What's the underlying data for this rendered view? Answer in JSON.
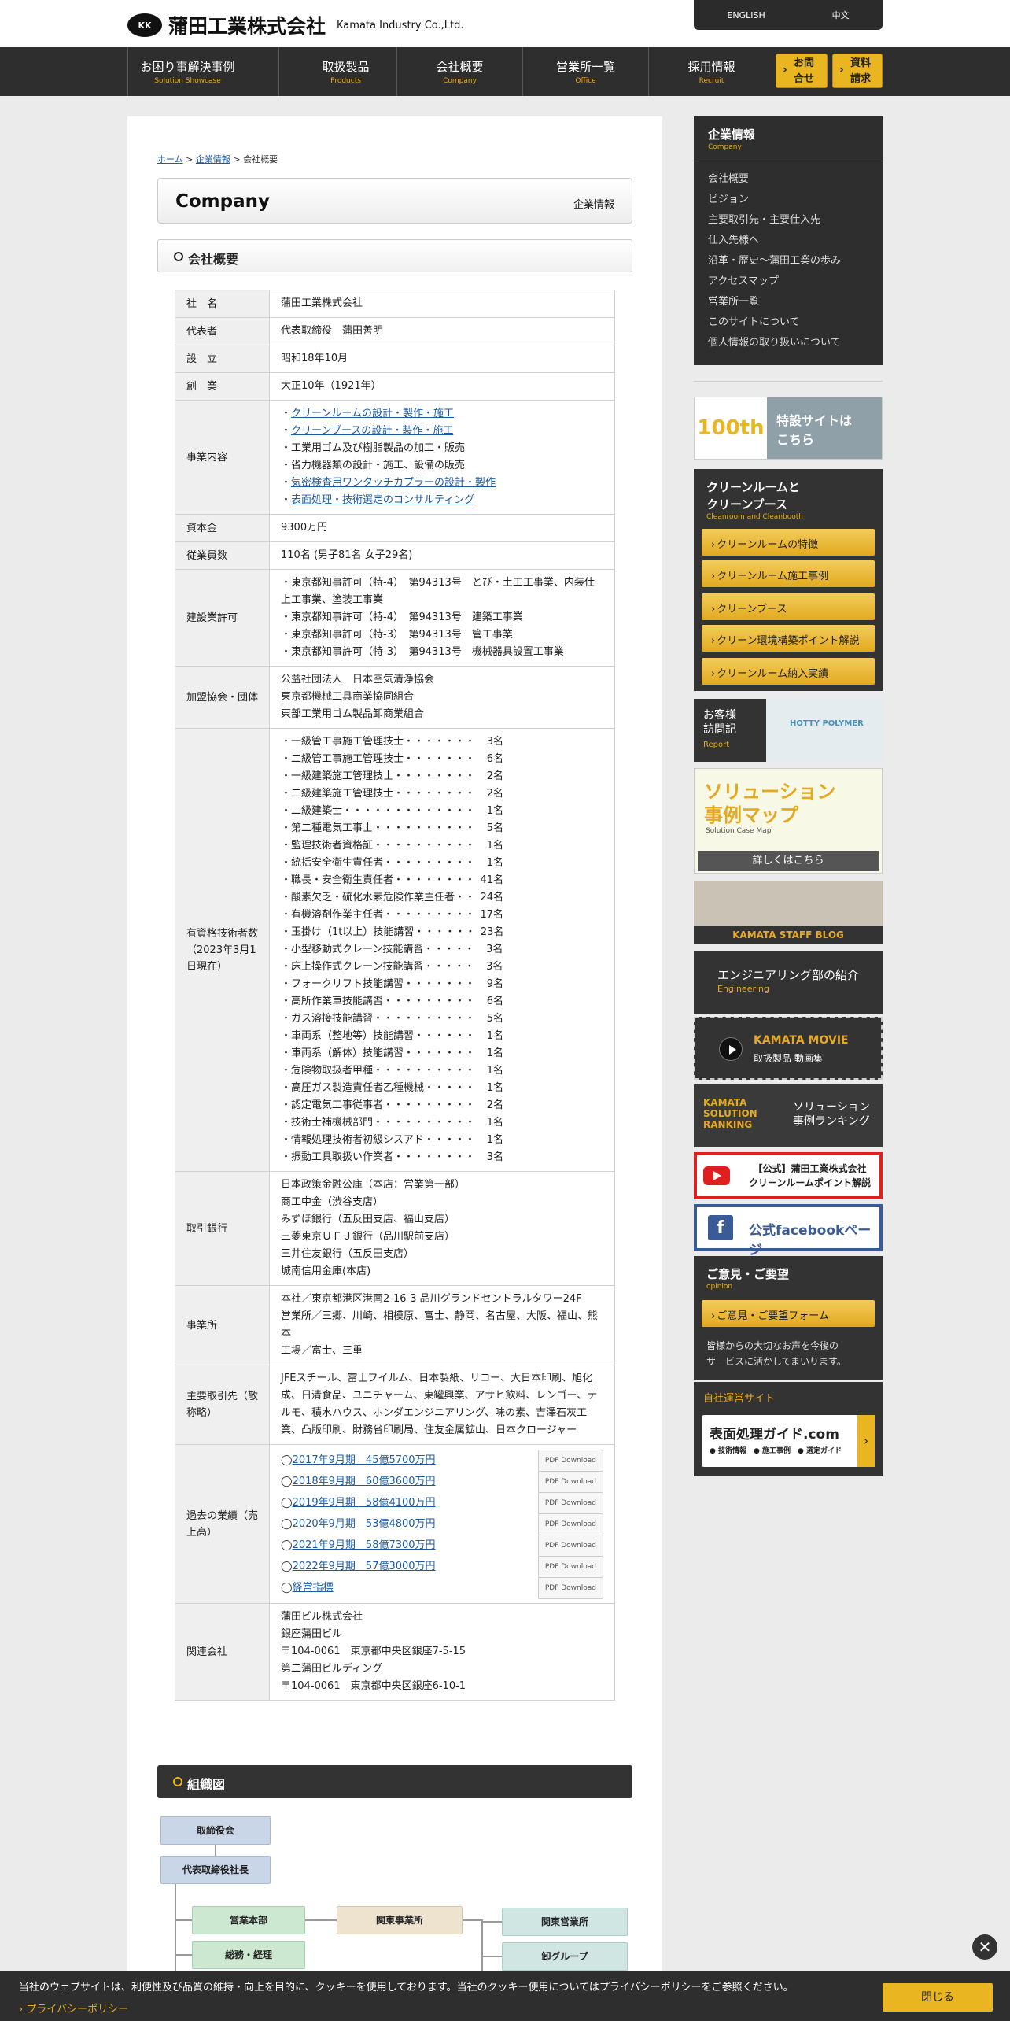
{
  "header": {
    "logo_mark": "KK",
    "logo_jp": "蒲田工業株式会社",
    "logo_en": "Kamata Industry Co.,Ltd.",
    "lang": [
      "ENGLISH",
      "中文"
    ]
  },
  "nav": {
    "items": [
      {
        "jp": "お困り事解決事例",
        "en": "Solution Showcase"
      },
      {
        "jp": "取扱製品",
        "en": "Products"
      },
      {
        "jp": "会社概要",
        "en": "Company"
      },
      {
        "jp": "営業所一覧",
        "en": "Office"
      },
      {
        "jp": "採用情報",
        "en": "Recruit"
      }
    ],
    "contact": "お問合せ",
    "request": "資料請求"
  },
  "breadcrumb": {
    "home": "ホーム",
    "sep": ">",
    "company": "企業情報",
    "current": "会社概要"
  },
  "page_title": {
    "en": "Company",
    "jp": "企業情報"
  },
  "section_title": "会社概要",
  "table": {
    "name": {
      "label": "社　名",
      "value": "蒲田工業株式会社"
    },
    "rep": {
      "label": "代表者",
      "value": "代表取締役　蒲田善明"
    },
    "founded": {
      "label": "設　立",
      "value": "昭和18年10月"
    },
    "created": {
      "label": "創　業",
      "value": "大正10年（1921年）"
    },
    "business": {
      "label": "事業内容",
      "items": [
        {
          "prefix": "・",
          "text": "クリーンルームの設計・製作・施工",
          "link": true
        },
        {
          "prefix": "・",
          "text": "クリーンブースの設計・製作・施工",
          "link": true
        },
        {
          "prefix": "・",
          "text": "工業用ゴム及び樹脂製品の加工・販売",
          "link": false
        },
        {
          "prefix": "・",
          "text": "省力機器類の設計・施工、設備の販売",
          "link": false
        },
        {
          "prefix": "・",
          "text": "気密検査用ワンタッチカプラーの設計・製作",
          "link": true
        },
        {
          "prefix": "・",
          "text": "表面処理・技術選定のコンサルティング",
          "link": true
        }
      ]
    },
    "capital": {
      "label": "資本金",
      "value": "9300万円"
    },
    "employees": {
      "label": "従業員数",
      "value": "110名 (男子81名 女子29名)"
    },
    "license": {
      "label": "建設業許可",
      "lines": [
        "・東京都知事許可（特-4）　第94313号　とび・土工工事業、内装仕上工事業、塗装工事業",
        "・東京都知事許可（特-4）　第94313号　建築工事業",
        "・東京都知事許可（特-3）　第94313号　管工事業",
        "・東京都知事許可（特-3）　第94313号　機械器具設置工事業"
      ]
    },
    "assoc": {
      "label": "加盟協会・団体",
      "lines": [
        "公益社団法人　日本空気清浄協会",
        "東京都機械工具商業協同組合",
        "東部工業用ゴム製品卸商業組合"
      ]
    },
    "qual": {
      "label": "有資格技術者数（2023年3月1日現在）",
      "items": [
        {
          "name": "・一級管工事施工管理技士・・・・・・・",
          "count": "3名"
        },
        {
          "name": "・二級管工事施工管理技士・・・・・・・",
          "count": "6名"
        },
        {
          "name": "・一級建築施工管理技士・・・・・・・・",
          "count": "2名"
        },
        {
          "name": "・二級建築施工管理技士・・・・・・・・",
          "count": "2名"
        },
        {
          "name": "・二級建築士・・・・・・・・・・・・・",
          "count": "1名"
        },
        {
          "name": "・第二種電気工事士・・・・・・・・・・",
          "count": "5名"
        },
        {
          "name": "・監理技術者資格証・・・・・・・・・・",
          "count": "1名"
        },
        {
          "name": "・統括安全衛生責任者・・・・・・・・・",
          "count": "1名"
        },
        {
          "name": "・職長・安全衛生責任者・・・・・・・・",
          "count": "41名"
        },
        {
          "name": "・酸素欠乏・硫化水素危険作業主任者・・",
          "count": "24名"
        },
        {
          "name": "・有機溶剤作業主任者・・・・・・・・・",
          "count": "17名"
        },
        {
          "name": "・玉掛け（1t以上）技能講習・・・・・・",
          "count": "23名"
        },
        {
          "name": "・小型移動式クレーン技能講習・・・・・",
          "count": "3名"
        },
        {
          "name": "・床上操作式クレーン技能講習・・・・・",
          "count": "3名"
        },
        {
          "name": "・フォークリフト技能講習・・・・・・・",
          "count": "9名"
        },
        {
          "name": "・高所作業車技能講習・・・・・・・・・",
          "count": "6名"
        },
        {
          "name": "・ガス溶接技能講習・・・・・・・・・・",
          "count": "5名"
        },
        {
          "name": "・車両系（整地等）技能講習・・・・・・",
          "count": "1名"
        },
        {
          "name": "・車両系（解体）技能講習・・・・・・・",
          "count": "1名"
        },
        {
          "name": "・危険物取扱者甲種・・・・・・・・・・",
          "count": "1名"
        },
        {
          "name": "・高圧ガス製造責任者乙種機械・・・・・",
          "count": "1名"
        },
        {
          "name": "・認定電気工事従事者・・・・・・・・・",
          "count": "2名"
        },
        {
          "name": "・技術士補機械部門・・・・・・・・・・",
          "count": "1名"
        },
        {
          "name": "・情報処理技術者初級シスアド・・・・・",
          "count": "1名"
        },
        {
          "name": "・振動工具取扱い作業者・・・・・・・・",
          "count": "3名"
        }
      ]
    },
    "banks": {
      "label": "取引銀行",
      "lines": [
        "日本政策金融公庫（本店：営業第一部）",
        "商工中金（渋谷支店）",
        "みずほ銀行（五反田支店、福山支店）",
        "三菱東京ＵＦＪ銀行（品川駅前支店）",
        "三井住友銀行（五反田支店）",
        "城南信用金庫(本店)"
      ]
    },
    "office": {
      "label": "事業所",
      "lines": [
        "本社／東京都港区港南2-16-3 品川グランドセントラルタワー24F",
        "営業所／三郷、川崎、相模原、富士、静岡、名古屋、大阪、福山、熊本",
        "工場／富士、三重"
      ]
    },
    "clients": {
      "label": "主要取引先（敬称略）",
      "value": "JFEスチール、富士フイルム、日本製紙、リコー、大日本印刷、旭化成、日清食品、ユニチャーム、東罐興業、アサヒ飲料、レンゴー、テルモ、積水ハウス、ホンダエンジニアリング、味の素、吉澤石灰工業、凸版印刷、財務省印刷局、住友金属鉱山、日本クロージャー"
    },
    "perf": {
      "label": "過去の業績（売上高）",
      "pdf_label": "PDF Download",
      "items": [
        {
          "mark": "◯",
          "text": "2017年9月期　45億5700万円"
        },
        {
          "mark": "◯",
          "text": "2018年9月期　60億3600万円"
        },
        {
          "mark": "◯",
          "text": "2019年9月期　58億4100万円"
        },
        {
          "mark": "◯",
          "text": "2020年9月期　53億4800万円"
        },
        {
          "mark": "◯",
          "text": "2021年9月期　58億7300万円"
        },
        {
          "mark": "◯",
          "text": "2022年9月期　57億3000万円"
        },
        {
          "mark": "◯",
          "text": "経営指標"
        }
      ]
    },
    "related": {
      "label": "関連会社",
      "lines": [
        "蒲田ビル株式会社",
        "銀座蒲田ビル",
        "〒104-0061　東京都中央区銀座7-5-15",
        "第二蒲田ビルディング",
        "〒104-0061　東京都中央区銀座6-10-1"
      ]
    }
  },
  "org": {
    "title": "組織図",
    "board": "取締役会",
    "president": "代表取締役社長",
    "sales_hq": "営業本部",
    "general": "総務・経理",
    "kanto_office": "関東事業所",
    "kanto_sales": "関東営業所",
    "wholesale": "卸グループ"
  },
  "sidebar": {
    "company_menu": {
      "title": "企業情報",
      "sub": "Company",
      "items": [
        "会社概要",
        "ビジョン",
        "主要取引先・主要仕入先",
        "仕入先様へ",
        "沿革・歴史〜蒲田工業の歩み",
        "アクセスマップ",
        "営業所一覧",
        "このサイトについて",
        "個人情報の取り扱いについて"
      ]
    },
    "anniv": {
      "mark": "100th",
      "text": "特設サイトは\nこちら"
    },
    "clean": {
      "title": "クリーンルームと\nクリーンブース",
      "sub": "Cleanroom and Cleanbooth",
      "buttons": [
        "クリーンルームの特徴",
        "クリーンルーム施工事例",
        "クリーンブース",
        "クリーン環境構築ポイント解説",
        "クリーンルーム納入実績"
      ]
    },
    "report": {
      "title": "お客様\n訪問記",
      "sub": "Report",
      "brand": "HOTTY POLYMER"
    },
    "solution_map": {
      "title": "ソリューション\n事例マップ",
      "sub": "Solution Case Map",
      "button": "詳しくはこちら"
    },
    "blog": "KAMATA STAFF BLOG",
    "engineering": {
      "title": "エンジニアリング部の紹介",
      "sub": "Engineering"
    },
    "movie": {
      "title": "KAMATA MOVIE",
      "sub": "取扱製品 動画集"
    },
    "ranking": {
      "left": "KAMATA\nSOLUTION\nRANKING",
      "right": "ソリューション\n事例ランキング"
    },
    "youtube": "【公式】蒲田工業株式会社\nクリーンルームポイント解説",
    "facebook": {
      "icon": "f",
      "text": "公式facebookページ"
    },
    "opinion": {
      "title": "ご意見・ご要望",
      "sub": "opinion",
      "button": "ご意見・ご要望フォーム",
      "text": "皆様からの大切なお声を今後の\nサービスに活かしてまいります。"
    },
    "own_site": {
      "title": "自社運営サイト",
      "card_title": "表面処理ガイド.com",
      "card_tags": "● 技術情報　● 施工事例　● 選定ガイド"
    }
  },
  "cookie": {
    "text": "当社のウェブサイトは、利便性及び品質の維持・向上を目的に、クッキーを使用しております。当社のクッキー使用についてはプライバシーポリシーをご参照ください。",
    "policy": "› プライバシーポリシー",
    "close": "閉じる",
    "close_x": "✕"
  },
  "colors": {
    "accent": "#e9b521",
    "dark": "#2e2e2e",
    "link": "#1d5aa0"
  }
}
